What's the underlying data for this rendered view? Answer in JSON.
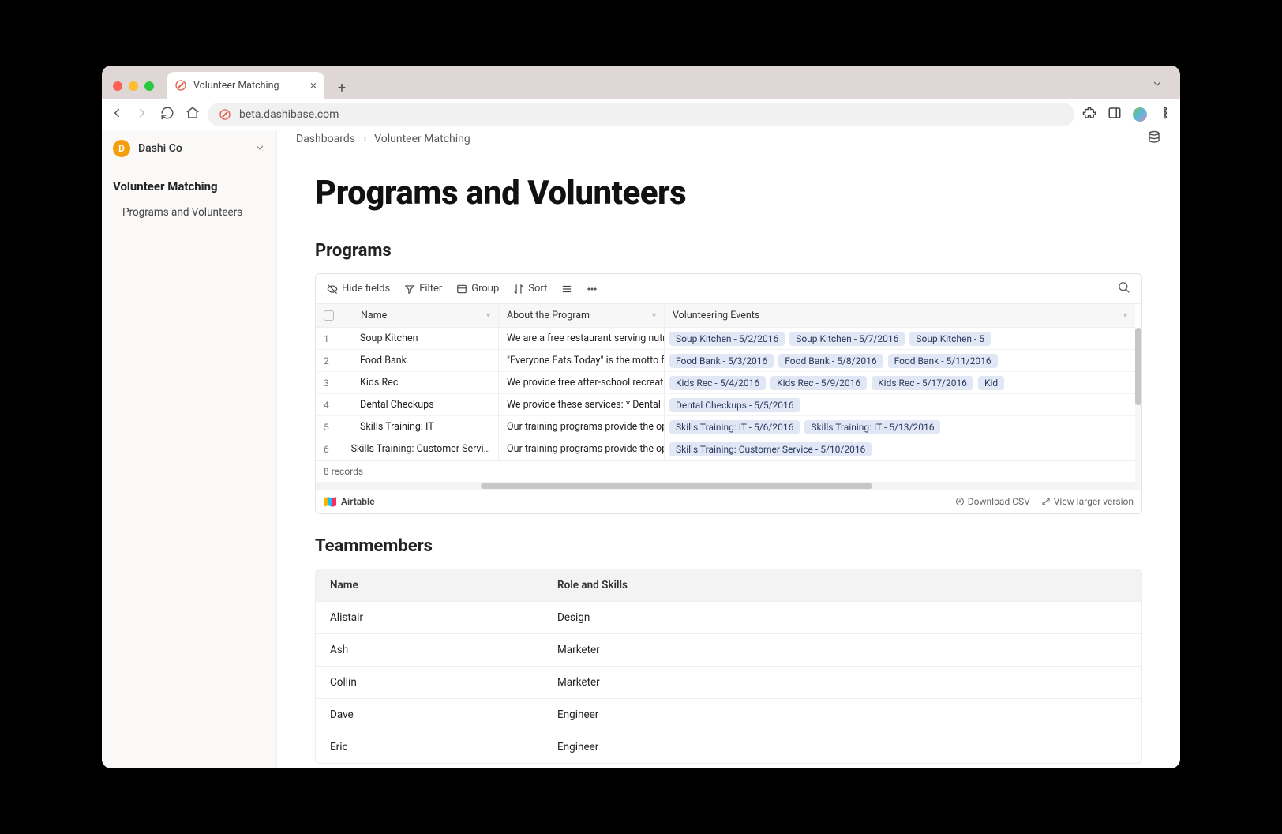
{
  "browser": {
    "tab_title": "Volunteer Matching",
    "url": "beta.dashibase.com"
  },
  "workspace": {
    "initial": "D",
    "name": "Dashi Co"
  },
  "sidebar": {
    "title": "Volunteer Matching",
    "items": [
      "Programs and Volunteers"
    ]
  },
  "breadcrumbs": {
    "root": "Dashboards",
    "current": "Volunteer Matching"
  },
  "page": {
    "title": "Programs and Volunteers"
  },
  "programs_section": {
    "heading": "Programs",
    "toolbar": {
      "hide_fields": "Hide fields",
      "filter": "Filter",
      "group": "Group",
      "sort": "Sort"
    },
    "columns": {
      "name": "Name",
      "about": "About the Program",
      "events": "Volunteering Events"
    },
    "rows": [
      {
        "idx": "1",
        "name": "Soup Kitchen",
        "about": "We are a free restaurant serving nutri…",
        "events": [
          "Soup Kitchen - 5/2/2016",
          "Soup Kitchen - 5/7/2016",
          "Soup Kitchen - 5"
        ]
      },
      {
        "idx": "2",
        "name": "Food Bank",
        "about": "\"Everyone Eats Today\" is the motto f…",
        "events": [
          "Food Bank - 5/3/2016",
          "Food Bank - 5/8/2016",
          "Food Bank - 5/11/2016"
        ]
      },
      {
        "idx": "3",
        "name": "Kids Rec",
        "about": "We provide free after-school recreati…",
        "events": [
          "Kids Rec - 5/4/2016",
          "Kids Rec - 5/9/2016",
          "Kids Rec - 5/17/2016",
          "Kid"
        ]
      },
      {
        "idx": "4",
        "name": "Dental Checkups",
        "about": "We provide these services: * Dental …",
        "events": [
          "Dental Checkups - 5/5/2016"
        ]
      },
      {
        "idx": "5",
        "name": "Skills Training: IT",
        "about": "Our training programs provide the op…",
        "events": [
          "Skills Training: IT - 5/6/2016",
          "Skills Training: IT - 5/13/2016"
        ]
      },
      {
        "idx": "6",
        "name": "Skills Training: Customer Servi…",
        "about": "Our training programs provide the op…",
        "events": [
          "Skills Training: Customer Service - 5/10/2016"
        ]
      }
    ],
    "record_count": "8 records",
    "brand": "Airtable",
    "download_csv": "Download CSV",
    "view_larger": "View larger version"
  },
  "team_section": {
    "heading": "Teammembers",
    "columns": {
      "name": "Name",
      "role": "Role and Skills"
    },
    "rows": [
      {
        "name": "Alistair",
        "role": "Design"
      },
      {
        "name": "Ash",
        "role": "Marketer"
      },
      {
        "name": "Collin",
        "role": "Marketer"
      },
      {
        "name": "Dave",
        "role": "Engineer"
      },
      {
        "name": "Eric",
        "role": "Engineer"
      }
    ]
  }
}
